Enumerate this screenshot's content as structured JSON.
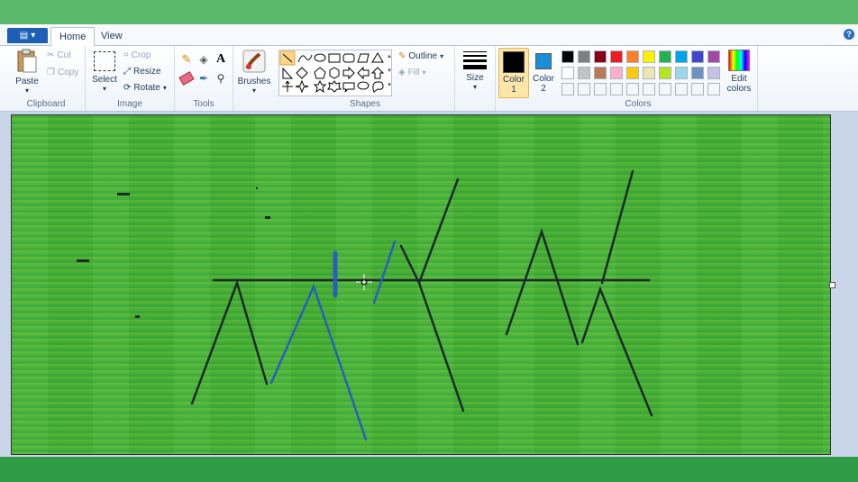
{
  "tabs": {
    "home": "Home",
    "view": "View"
  },
  "help_label": "?",
  "clipboard": {
    "paste": "Paste",
    "cut": "Cut",
    "copy": "Copy",
    "label": "Clipboard"
  },
  "image": {
    "select": "Select",
    "crop": "Crop",
    "resize": "Resize",
    "rotate": "Rotate",
    "label": "Image"
  },
  "tools": {
    "label": "Tools",
    "brushes": "Brushes"
  },
  "shapes": {
    "outline": "Outline",
    "fill": "Fill",
    "label": "Shapes"
  },
  "size": {
    "label": "Size"
  },
  "color1": {
    "label1": "Color",
    "label2": "1",
    "value": "#000000"
  },
  "color2": {
    "label1": "Color",
    "label2": "2",
    "value": "#1a8fd8"
  },
  "colors": {
    "label": "Colors",
    "edit1": "Edit",
    "edit2": "colors",
    "row1": [
      "#000000",
      "#7f7f7f",
      "#880015",
      "#ed1c24",
      "#ff7f27",
      "#fff200",
      "#22b14c",
      "#00a2e8",
      "#3f48cc",
      "#a349a4"
    ],
    "row2": [
      "#ffffff",
      "#c3c3c3",
      "#b97a57",
      "#ffaec9",
      "#ffc90e",
      "#efe4b0",
      "#b5e61d",
      "#99d9ea",
      "#7092be",
      "#c8bfe7"
    ],
    "row3": [
      "#f4f6f9",
      "#f4f6f9",
      "#f4f6f9",
      "#f4f6f9",
      "#f4f6f9",
      "#f4f6f9",
      "#f4f6f9",
      "#f4f6f9",
      "#f4f6f9",
      "#f4f6f9"
    ]
  }
}
